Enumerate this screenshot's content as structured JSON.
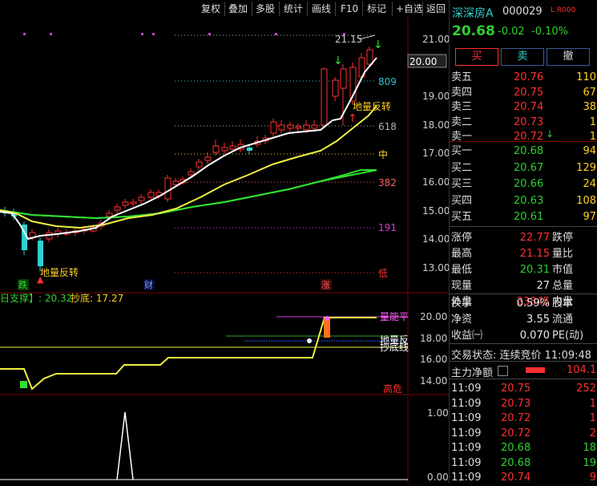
{
  "toolbar": {
    "buttons": [
      "复权",
      "叠加",
      "多股",
      "统计",
      "画线",
      "F10",
      "标记",
      "+自选",
      "返回"
    ]
  },
  "stock": {
    "name": "深深房A",
    "code": "000029",
    "flag": "L R000",
    "price": "20.68",
    "change": "-0.02",
    "change_pct": "-0.10%"
  },
  "trade_buttons": {
    "buy": "买",
    "sell": "卖",
    "cancel": "撤"
  },
  "price_axis": {
    "labels": [
      "21.00",
      "20.00",
      "19.00",
      "18.00",
      "17.00",
      "16.00",
      "15.00",
      "14.00",
      "13.00"
    ],
    "current": "20.00"
  },
  "fib_levels": [
    {
      "label": "809",
      "color": "#30c0d0"
    },
    {
      "label": "618",
      "color": "#b0b0b0"
    },
    {
      "label": "中",
      "color": "#ffd020"
    },
    {
      "label": "382",
      "color": "#ff6060"
    },
    {
      "label": "191",
      "color": "#d040d0"
    },
    {
      "label": "低",
      "color": "#ff3030"
    }
  ],
  "annotations": {
    "high_price": "21.15",
    "bottom_reversal_1": "地量反转",
    "bottom_reversal_2": "地量反转",
    "tag_die": "跌",
    "tag_cai": "财",
    "tag_zhang": "涨"
  },
  "indicator": {
    "title": "日支撑】: 20.32",
    "chaodi": "抄底: 17.27",
    "labels": {
      "liangneng": "量能平",
      "diliang": "地量反",
      "chaodixian": "抄底线",
      "gaowei": "高危"
    },
    "axis": [
      "20.00",
      "18.00",
      "16.00",
      "14.00"
    ]
  },
  "sub_indicator": {
    "axis": [
      "1.00",
      "0.00"
    ]
  },
  "order_book": {
    "asks": [
      {
        "label": "卖五",
        "price": "20.76",
        "vol": "110"
      },
      {
        "label": "卖四",
        "price": "20.75",
        "vol": "67"
      },
      {
        "label": "卖三",
        "price": "20.74",
        "vol": "38"
      },
      {
        "label": "卖二",
        "price": "20.73",
        "vol": "1"
      },
      {
        "label": "卖一",
        "price": "20.72",
        "vol": "1"
      }
    ],
    "bids": [
      {
        "label": "买一",
        "price": "20.68",
        "vol": "94"
      },
      {
        "label": "买二",
        "price": "20.67",
        "vol": "129"
      },
      {
        "label": "买三",
        "price": "20.66",
        "vol": "24"
      },
      {
        "label": "买四",
        "price": "20.63",
        "vol": "108"
      },
      {
        "label": "买五",
        "price": "20.61",
        "vol": "97"
      }
    ]
  },
  "stats": [
    {
      "l1": "涨停",
      "v1": "22.77",
      "l2": "跌停"
    },
    {
      "l1": "最高",
      "v1": "21.15",
      "l2": "量比"
    },
    {
      "l1": "最低",
      "v1": "20.31",
      "l2": "市值"
    },
    {
      "l1": "现量",
      "v1": "27",
      "l2": "总量"
    },
    {
      "l1": "外盘",
      "v1": "23845",
      "l2": "内盘"
    }
  ],
  "stats2": [
    {
      "l1": "换手",
      "v1": "0.59%",
      "l2": "股本"
    },
    {
      "l1": "净资",
      "v1": "3.55",
      "l2": "流通"
    },
    {
      "l1": "收益㈠",
      "v1": "0.070",
      "l2": "PE(动)"
    }
  ],
  "trade_state": "交易状态: 连续竞价 11:09:48",
  "net_flow": {
    "label": "主力净额",
    "value": "104.1"
  },
  "ticks": [
    {
      "time": "11:09",
      "price": "20.75",
      "vol": "252",
      "color": "#ff3030"
    },
    {
      "time": "11:09",
      "price": "20.73",
      "vol": "1",
      "color": "#ff3030"
    },
    {
      "time": "11:09",
      "price": "20.72",
      "vol": "1",
      "color": "#ff3030"
    },
    {
      "time": "11:09",
      "price": "20.72",
      "vol": "2",
      "color": "#ff3030"
    },
    {
      "time": "11:09",
      "price": "20.68",
      "vol": "18",
      "color": "#30d030"
    },
    {
      "time": "11:09",
      "price": "20.68",
      "vol": "19",
      "color": "#30d030"
    },
    {
      "time": "11:09",
      "price": "20.74",
      "vol": "9",
      "color": "#ff3030"
    }
  ],
  "colors": {
    "up": "#ff3030",
    "down": "#30d0d0",
    "ma_white": "#ffffff",
    "ma_yellow": "#f0f040",
    "ma_green": "#30e030",
    "accent_blue": "#3a5a9a"
  }
}
